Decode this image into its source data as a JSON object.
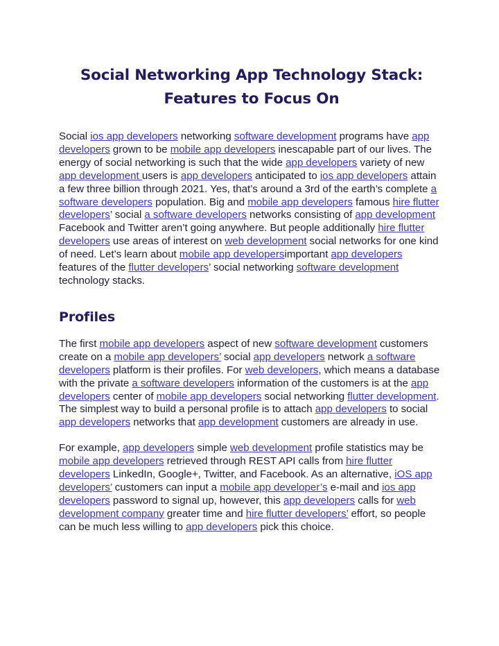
{
  "document": {
    "title_line_1": "Social Networking App Technology Stack:",
    "title_line_2": "Features to Focus On",
    "section_heading": "Profiles",
    "colors": {
      "heading": "#221c5e",
      "body_text": "#1d1d3c",
      "link": "#3a34c4",
      "background": "#ffffff"
    },
    "paragraph_1": {
      "runs": [
        {
          "text": "Social ",
          "link": false
        },
        {
          "text": "ios app developers",
          "link": true
        },
        {
          "text": " networking ",
          "link": false
        },
        {
          "text": "software development",
          "link": true
        },
        {
          "text": " programs have ",
          "link": false
        },
        {
          "text": "app developers",
          "link": true
        },
        {
          "text": " grown to be ",
          "link": false
        },
        {
          "text": "mobile app developers",
          "link": true
        },
        {
          "text": " inescapable part of our lives. The energy of social networking is such that the wide ",
          "link": false
        },
        {
          "text": "app developers",
          "link": true
        },
        {
          "text": " variety of new ",
          "link": false
        },
        {
          "text": "app development ",
          "link": true
        },
        {
          "text": "users is ",
          "link": false
        },
        {
          "text": "app developers",
          "link": true
        },
        {
          "text": " anticipated to ",
          "link": false
        },
        {
          "text": "ios app developers",
          "link": true
        },
        {
          "text": " attain a few three billion through 2021. Yes, that’s around a 3rd of the earth’s complete ",
          "link": false
        },
        {
          "text": "a software developers",
          "link": true
        },
        {
          "text": " population. Big and ",
          "link": false
        },
        {
          "text": "mobile app developers",
          "link": true
        },
        {
          "text": " famous ",
          "link": false
        },
        {
          "text": "hire flutter developers",
          "link": true
        },
        {
          "text": "’ social ",
          "link": false
        },
        {
          "text": "a software developers",
          "link": true
        },
        {
          "text": " networks consisting of ",
          "link": false
        },
        {
          "text": "app development",
          "link": true
        },
        {
          "text": " Facebook and Twitter aren’t going anywhere. But people additionally ",
          "link": false
        },
        {
          "text": "hire flutter developers",
          "link": true
        },
        {
          "text": " use areas of interest on ",
          "link": false
        },
        {
          "text": "web development",
          "link": true
        },
        {
          "text": " social networks for one kind of need. Let’s learn about ",
          "link": false
        },
        {
          "text": "mobile app developers",
          "link": true
        },
        {
          "text": "important ",
          "link": false
        },
        {
          "text": "app developers",
          "link": true
        },
        {
          "text": " features of the ",
          "link": false
        },
        {
          "text": "flutter developers",
          "link": true
        },
        {
          "text": "’ social networking ",
          "link": false
        },
        {
          "text": "software development",
          "link": true
        },
        {
          "text": " technology stacks.",
          "link": false
        }
      ]
    },
    "paragraph_2": {
      "runs": [
        {
          "text": "The first ",
          "link": false
        },
        {
          "text": "mobile app developers",
          "link": true
        },
        {
          "text": " aspect of new ",
          "link": false
        },
        {
          "text": "software development",
          "link": true
        },
        {
          "text": " customers create on a ",
          "link": false
        },
        {
          "text": "mobile app developers’",
          "link": true
        },
        {
          "text": " social ",
          "link": false
        },
        {
          "text": "app developers",
          "link": true
        },
        {
          "text": " network ",
          "link": false
        },
        {
          "text": "a software developers",
          "link": true
        },
        {
          "text": " platform is their profiles. For ",
          "link": false
        },
        {
          "text": "web developers",
          "link": true
        },
        {
          "text": ", which means a database with the private ",
          "link": false
        },
        {
          "text": "a software developers",
          "link": true
        },
        {
          "text": " information of the customers is at the ",
          "link": false
        },
        {
          "text": "app developers",
          "link": true
        },
        {
          "text": " center of ",
          "link": false
        },
        {
          "text": "mobile app developers",
          "link": true
        },
        {
          "text": " social networking ",
          "link": false
        },
        {
          "text": "flutter development",
          "link": true
        },
        {
          "text": ". The simplest way to build a personal profile is to attach ",
          "link": false
        },
        {
          "text": "app developers",
          "link": true
        },
        {
          "text": " to social ",
          "link": false
        },
        {
          "text": "app developers",
          "link": true
        },
        {
          "text": " networks that ",
          "link": false
        },
        {
          "text": "app development",
          "link": true
        },
        {
          "text": " customers are already in use.",
          "link": false
        }
      ]
    },
    "paragraph_3": {
      "runs": [
        {
          "text": "For example, ",
          "link": false
        },
        {
          "text": "app developers",
          "link": true
        },
        {
          "text": " simple ",
          "link": false
        },
        {
          "text": "web development",
          "link": true
        },
        {
          "text": " profile statistics may be ",
          "link": false
        },
        {
          "text": "mobile app developers",
          "link": true
        },
        {
          "text": " retrieved through REST API calls from ",
          "link": false
        },
        {
          "text": "hire flutter developers",
          "link": true
        },
        {
          "text": " LinkedIn, Google+, Twitter, and Facebook. As an alternative, ",
          "link": false
        },
        {
          "text": "iOS app developers’",
          "link": true
        },
        {
          "text": " customers can input a ",
          "link": false
        },
        {
          "text": "mobile app developer’s",
          "link": true
        },
        {
          "text": " e-mail and ",
          "link": false
        },
        {
          "text": "ios app developers",
          "link": true
        },
        {
          "text": " password to signal up, however, this ",
          "link": false
        },
        {
          "text": "app developers",
          "link": true
        },
        {
          "text": " calls for ",
          "link": false
        },
        {
          "text": "web development company",
          "link": true
        },
        {
          "text": " greater time and ",
          "link": false
        },
        {
          "text": "hire flutter developers’",
          "link": true
        },
        {
          "text": " effort, so people can be much less willing to ",
          "link": false
        },
        {
          "text": "app developers",
          "link": true
        },
        {
          "text": " pick this choice.",
          "link": false
        }
      ]
    }
  }
}
